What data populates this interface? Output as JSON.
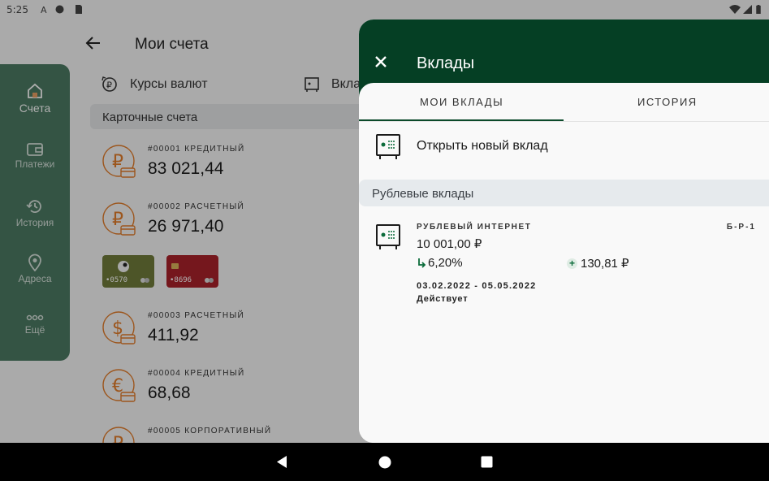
{
  "status_bar": {
    "time": "5:25"
  },
  "background": {
    "title": "Мои счета",
    "fx_label": "Курсы валют",
    "deposits_label_partial": "Вкла",
    "card_section": "Карточные счета",
    "accounts": [
      {
        "label": "#00001 КРЕДИТНЫЙ",
        "amount": "83 021,44",
        "currency_symbol": "₽"
      },
      {
        "label": "#00002 РАСЧЕТНЫЙ",
        "amount": "26 971,40",
        "currency_symbol": "₽"
      },
      {
        "label": "#00003 РАСЧЕТНЫЙ",
        "amount": "411,92",
        "currency_symbol": "$"
      },
      {
        "label": "#00004 КРЕДИТНЫЙ",
        "amount": "68,68",
        "currency_symbol": "€"
      },
      {
        "label": "#00005 КОРПОРАТИВНЫЙ",
        "amount": "",
        "currency_symbol": "₽"
      }
    ],
    "cards": [
      {
        "number": "•0570",
        "color": "#6f7a3a"
      },
      {
        "number": "•8696",
        "color": "#a8222a"
      }
    ]
  },
  "side_nav": {
    "items": [
      {
        "label": "Счета",
        "icon": "home-icon",
        "active": true
      },
      {
        "label": "Платежи",
        "icon": "wallet-icon",
        "active": false
      },
      {
        "label": "История",
        "icon": "history-icon",
        "active": false
      },
      {
        "label": "Адреса",
        "icon": "location-pin-icon",
        "active": false
      },
      {
        "label": "Ещё",
        "icon": "more-dots-icon",
        "active": false
      }
    ]
  },
  "sheet": {
    "title": "Вклады",
    "tabs": [
      {
        "label": "МОИ ВКЛАДЫ",
        "active": true
      },
      {
        "label": "ИСТОРИЯ",
        "active": false
      }
    ],
    "open_new": "Открыть новый вклад",
    "section": "Рублевые вклады",
    "deposit": {
      "name": "РУБЛЕВЫЙ ИНТЕРНЕТ",
      "code": "Б-Р-1",
      "amount": "10 001,00 ₽",
      "rate": "6,20%",
      "income": "130,81 ₽",
      "period": "03.02.2022 - 05.05.2022",
      "status": "Действует"
    }
  },
  "colors": {
    "brand_green": "#053f24",
    "accent_orange": "#e07b2a",
    "safe_green": "#0b6b3a"
  }
}
